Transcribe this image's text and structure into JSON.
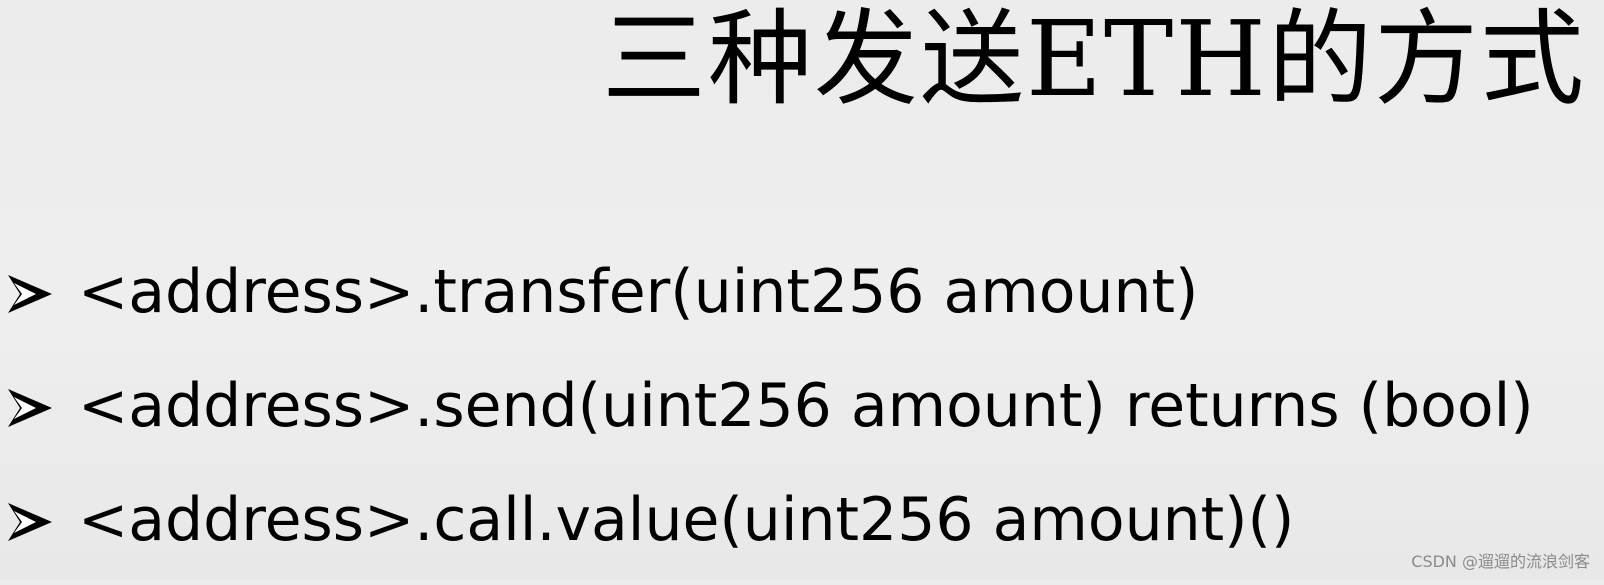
{
  "slide": {
    "title": "三种发送ETH的方式",
    "bullets": [
      {
        "icon": "arrow-bullet-icon",
        "text": "<address>.transfer(uint256 amount)"
      },
      {
        "icon": "arrow-bullet-icon",
        "text": "<address>.send(uint256 amount) returns (bool)"
      },
      {
        "icon": "arrow-bullet-icon",
        "text": "<address>.call.value(uint256 amount)()"
      }
    ]
  },
  "watermark": {
    "text": "CSDN @遛遛的流浪剑客"
  },
  "colors": {
    "background": "#ececec",
    "text": "#000000",
    "watermark": "#8a8a8a"
  }
}
